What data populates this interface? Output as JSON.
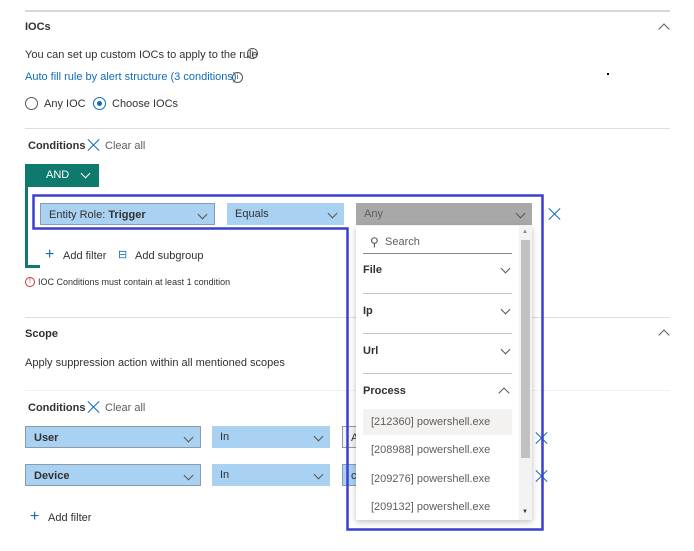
{
  "iocs": {
    "title": "IOCs",
    "description": "You can set up custom IOCs to apply to the rule",
    "autofill_link": "Auto fill rule by alert structure (3 conditions)",
    "radio_any": "Any IOC",
    "radio_choose": "Choose IOCs",
    "selected": "Choose IOCs",
    "conditions_label": "Conditions",
    "clear_all": "Clear all",
    "operator": "AND",
    "row": {
      "field_prefix": "Entity Role: ",
      "field_value": "Trigger",
      "operator": "Equals",
      "value_placeholder": "Any"
    },
    "add_filter": "Add filter",
    "add_subgroup": "Add subgroup",
    "error": "IOC Conditions must contain at least 1 condition"
  },
  "dropdown": {
    "search_placeholder": "Search",
    "sections": [
      {
        "label": "File",
        "expanded": false
      },
      {
        "label": "Ip",
        "expanded": false
      },
      {
        "label": "Url",
        "expanded": false
      },
      {
        "label": "Process",
        "expanded": true
      }
    ],
    "items": [
      "[212360] powershell.exe",
      "[208988] powershell.exe",
      "[209276] powershell.exe",
      "[209132] powershell.exe"
    ]
  },
  "scope": {
    "title": "Scope",
    "description": "Apply suppression action within all mentioned scopes",
    "conditions_label": "Conditions",
    "clear_all": "Clear all",
    "rows": [
      {
        "field": "User",
        "operator": "In",
        "value": "A"
      },
      {
        "field": "Device",
        "operator": "In",
        "value": "co"
      }
    ],
    "add_filter": "Add filter"
  },
  "colors": {
    "accent": "#0f6cbd",
    "and_teal": "#0e7a6e",
    "highlight": "#3b3fd1",
    "field_blue": "#a9d1f2"
  }
}
